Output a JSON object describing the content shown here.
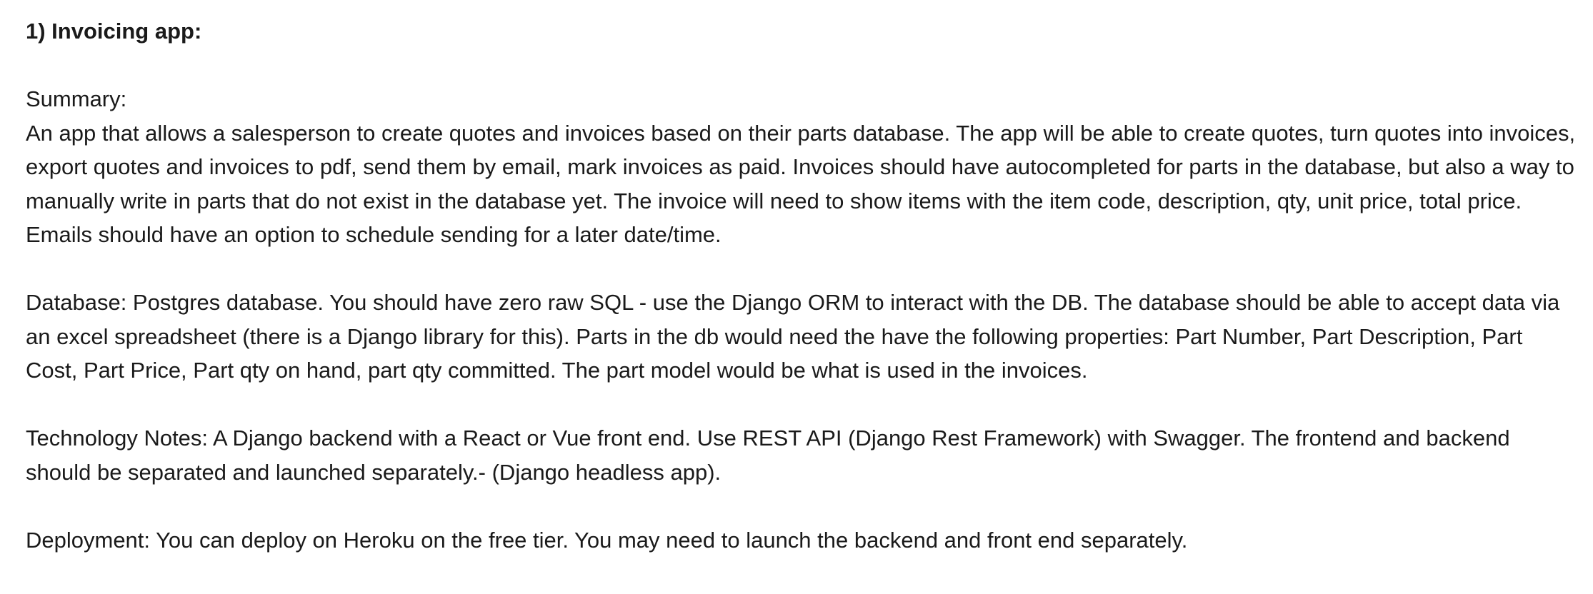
{
  "heading": "1) Invoicing app:",
  "summary_label": "Summary:",
  "summary_text": "An app that allows a salesperson to create quotes and invoices based on their parts database. The app will be able to create quotes, turn quotes into invoices, export quotes and invoices to pdf, send them by email, mark invoices as paid. Invoices should have autocompleted for parts in the database, but also a way to manually write in parts that do not exist in the database yet. The invoice will need to show items with the item code, description, qty, unit price, total price. Emails should have an option to schedule sending for a later date/time.",
  "database_text": "Database: Postgres database. You should have zero raw SQL - use the Django ORM to interact with the DB. The database should be able to accept data via an excel spreadsheet (there is a Django library for this). Parts in the db would need the have the following properties: Part Number, Part Description, Part Cost, Part Price, Part qty on hand, part qty committed. The part model would be what is used in the invoices.",
  "technology_text": "Technology Notes: A Django backend with a React or Vue front end. Use REST API (Django Rest Framework) with Swagger. The frontend and backend should be separated and launched separately.- (Django headless app).",
  "deployment_text": "Deployment: You can deploy on Heroku on the free tier. You may need to launch the backend and front end separately."
}
